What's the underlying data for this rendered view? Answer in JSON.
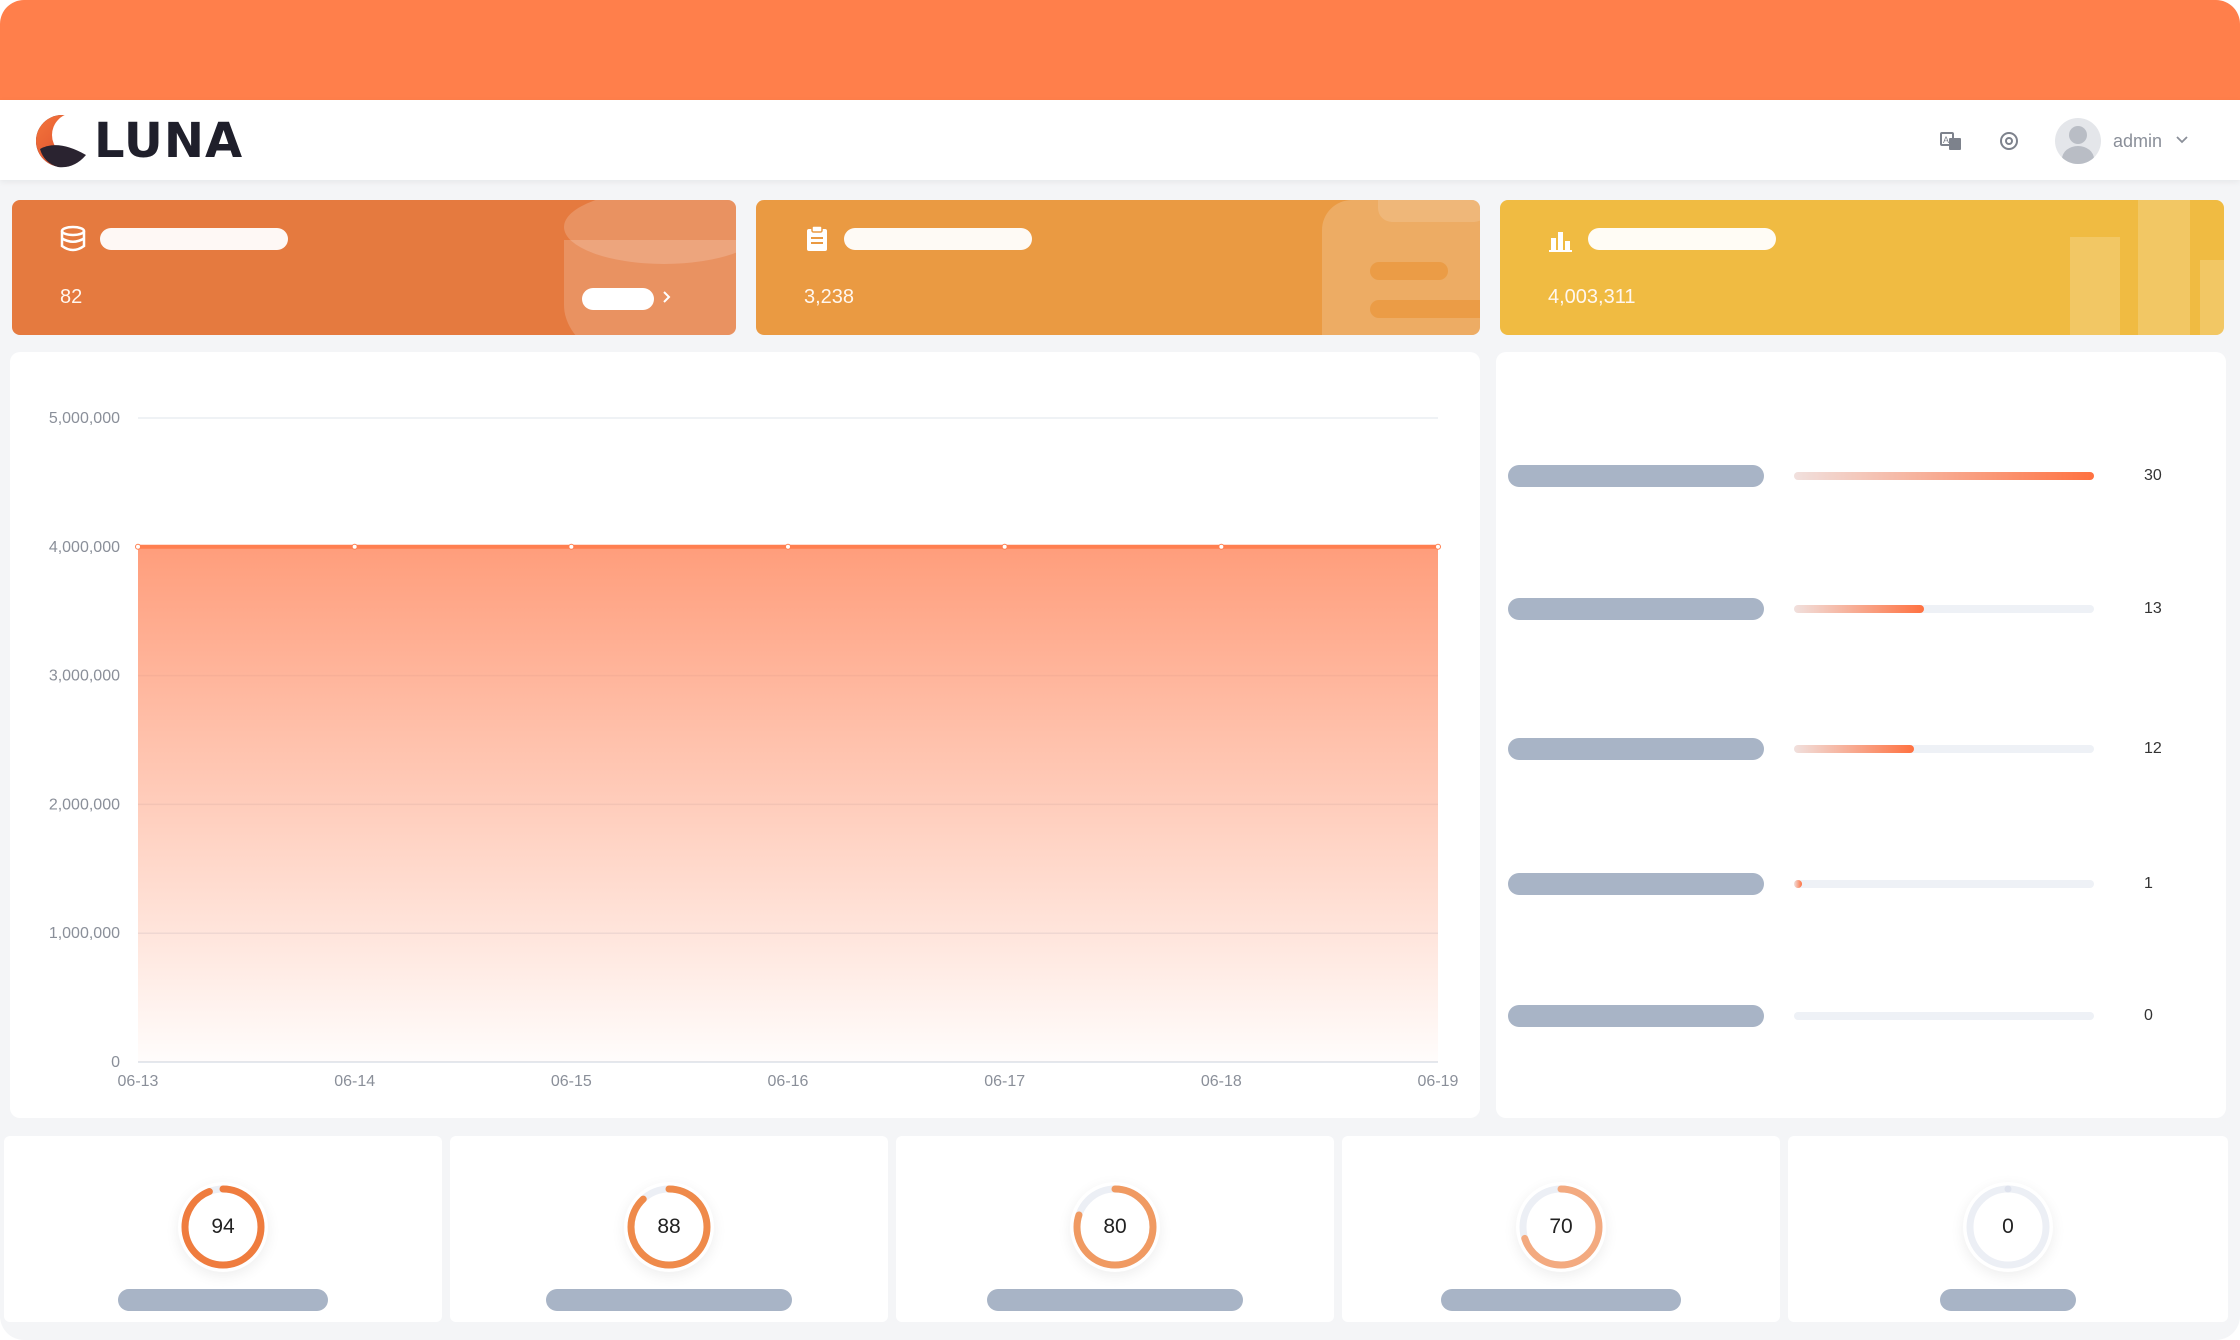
{
  "app": {
    "name": "LUNA"
  },
  "header": {
    "user_name": "admin"
  },
  "stats": [
    {
      "value": "82"
    },
    {
      "value": "3,238"
    },
    {
      "value": "4,003,311"
    }
  ],
  "chart_data": {
    "type": "area",
    "x": [
      "06-13",
      "06-14",
      "06-15",
      "06-16",
      "06-17",
      "06-18",
      "06-19"
    ],
    "series": [
      {
        "values": [
          4000000,
          4000000,
          4000000,
          4000000,
          4000000,
          4000000,
          4000000
        ]
      }
    ],
    "ylim": [
      0,
      5000000
    ],
    "yticks": [
      "0",
      "1,000,000",
      "2,000,000",
      "3,000,000",
      "4,000,000",
      "5,000,000"
    ],
    "grid": true,
    "color": "#ff7f50"
  },
  "ranking": [
    {
      "value": 30,
      "label": "30"
    },
    {
      "value": 13,
      "label": "13"
    },
    {
      "value": 12,
      "label": "12"
    },
    {
      "value": 1,
      "label": "1"
    },
    {
      "value": 0,
      "label": "0"
    }
  ],
  "ranking_max": 30,
  "gauges": [
    {
      "value": 94,
      "label": "94"
    },
    {
      "value": 88,
      "label": "88"
    },
    {
      "value": 80,
      "label": "80"
    },
    {
      "value": 70,
      "label": "70"
    },
    {
      "value": 0,
      "label": "0"
    }
  ],
  "colors": {
    "top_bar": "#ff7f4b",
    "card_1": "#e57a3f",
    "card_2": "#ea9a42",
    "card_3": "#f0bb42",
    "accent": "#ff7140",
    "placeholder": "#a8b4c6"
  }
}
